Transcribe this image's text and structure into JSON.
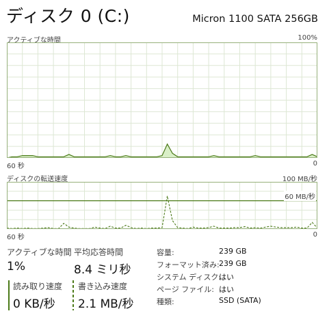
{
  "header": {
    "title": "ディスク 0 (C:)",
    "model": "Micron 1100 SATA 256GB"
  },
  "colors": {
    "accent": "#4b7a18",
    "fill": "#d9efc7",
    "grid": "#dde7d4",
    "border": "#96b07a"
  },
  "active_chart": {
    "label": "アクティブな時間",
    "max_label": "100%",
    "x_left": "60 秒",
    "x_right": "0"
  },
  "transfer_chart": {
    "label": "ディスクの転送速度",
    "max_label": "100 MB/秒",
    "threshold_label": "60 MB/秒",
    "x_left": "60 秒",
    "x_right": "0"
  },
  "chart_data": [
    {
      "type": "area",
      "title": "アクティブな時間",
      "x": [
        0,
        1,
        2,
        3,
        4,
        5,
        6,
        7,
        8,
        9,
        10,
        11,
        12,
        13,
        14,
        15,
        16,
        17,
        18,
        19,
        20,
        21,
        22,
        23,
        24,
        25,
        26,
        27,
        28,
        29,
        30,
        31,
        32,
        33,
        34,
        35,
        36,
        37,
        38,
        39,
        40,
        41,
        42,
        43,
        44,
        45,
        46,
        47,
        48,
        49,
        50,
        51,
        52,
        53,
        54,
        55,
        56,
        57,
        58,
        59,
        60
      ],
      "series": [
        {
          "values": [
            0,
            1,
            1,
            2,
            2,
            2,
            1,
            1,
            1,
            1,
            1,
            1,
            3,
            1,
            1,
            1,
            1,
            1,
            1,
            1,
            2,
            1,
            1,
            2,
            1,
            1,
            1,
            1,
            1,
            1,
            2,
            12,
            4,
            1,
            1,
            1,
            1,
            1,
            1,
            1,
            2,
            1,
            1,
            1,
            1,
            1,
            1,
            1,
            2,
            1,
            1,
            1,
            1,
            1,
            1,
            1,
            1,
            1,
            1,
            3,
            1
          ]
        }
      ],
      "ylim": [
        0,
        100
      ],
      "grid": true
    },
    {
      "type": "line",
      "title": "ディスクの転送速度",
      "x": [
        0,
        1,
        2,
        3,
        4,
        5,
        6,
        7,
        8,
        9,
        10,
        11,
        12,
        13,
        14,
        15,
        16,
        17,
        18,
        19,
        20,
        21,
        22,
        23,
        24,
        25,
        26,
        27,
        28,
        29,
        30,
        31,
        32,
        33,
        34,
        35,
        36,
        37,
        38,
        39,
        40,
        41,
        42,
        43,
        44,
        45,
        46,
        47,
        48,
        49,
        50,
        51,
        52,
        53,
        54,
        55,
        56,
        57,
        58,
        59,
        60
      ],
      "series": [
        {
          "values": [
            2,
            1,
            2,
            1,
            2,
            1,
            1,
            2,
            3,
            1,
            1,
            12,
            4,
            2,
            1,
            1,
            1,
            4,
            2,
            1,
            6,
            2,
            2,
            8,
            3,
            1,
            2,
            1,
            2,
            2,
            3,
            70,
            18,
            3,
            2,
            1,
            4,
            2,
            2,
            3,
            6,
            2,
            2,
            2,
            3,
            3,
            5,
            2,
            3,
            2,
            4,
            6,
            4,
            3,
            3,
            3,
            4,
            2,
            2,
            14,
            2
          ]
        }
      ],
      "ylim": [
        0,
        100
      ],
      "threshold": 60,
      "grid": true
    }
  ],
  "stats": {
    "active_time": {
      "label": "アクティブな時間",
      "value": "1%"
    },
    "avg_response": {
      "label": "平均応答時間",
      "value": "8.4 ミリ秒"
    },
    "read_speed": {
      "label": "読み取り速度",
      "value": "0 KB/秒"
    },
    "write_speed": {
      "label": "書き込み速度",
      "value": "2.1 MB/秒"
    }
  },
  "info": [
    {
      "label": "容量:",
      "value": "239 GB"
    },
    {
      "label": "フォーマット済み:",
      "value": "239 GB"
    },
    {
      "label": "システム ディスク:",
      "value": "はい"
    },
    {
      "label": "ページ ファイル:",
      "value": "はい"
    },
    {
      "label": "種類:",
      "value": "SSD (SATA)"
    }
  ]
}
